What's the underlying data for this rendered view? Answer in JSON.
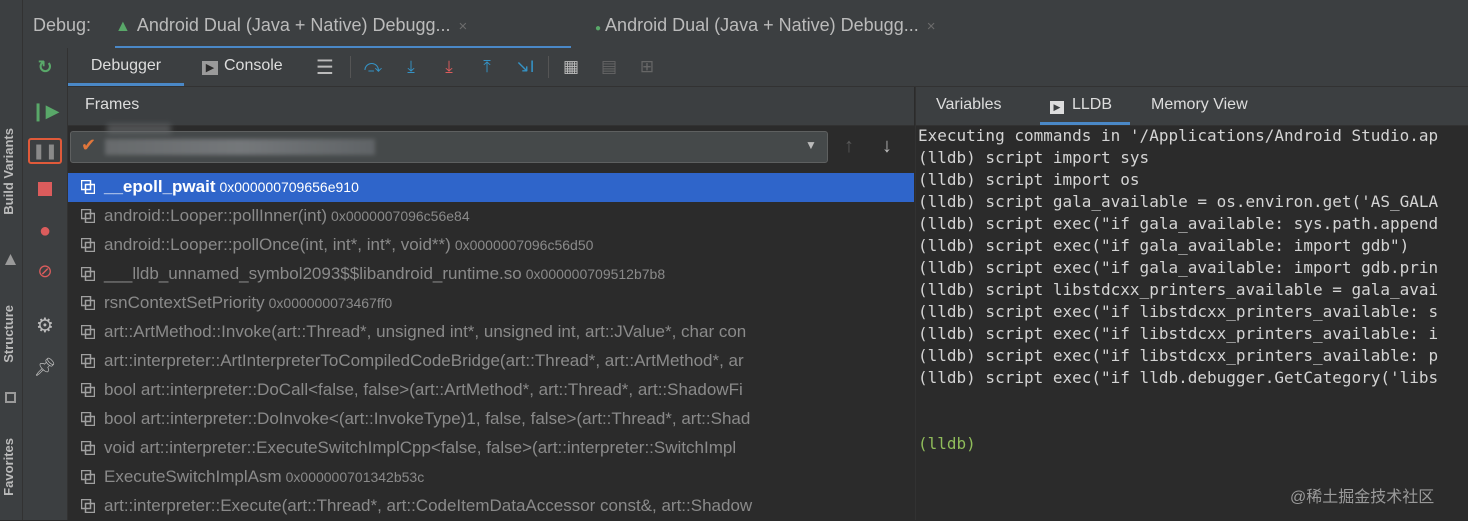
{
  "left_strip": {
    "labels": [
      "Build Variants",
      "Structure",
      "Favorites"
    ]
  },
  "header": {
    "debug_label": "Debug:",
    "sessions": [
      {
        "label": "Android Dual (Java + Native) Debugg...",
        "close": "×"
      },
      {
        "label": "Android Dual (Java + Native) Debugg...",
        "close": "×"
      }
    ]
  },
  "toolbar": {
    "tabs": [
      {
        "label": "Debugger"
      },
      {
        "label": "Console"
      }
    ],
    "icons": [
      "menu-icon",
      "step-over-icon",
      "step-into-icon",
      "force-step-into-icon",
      "step-out-icon",
      "run-to-cursor-icon",
      "evaluate-icon",
      "grid-icon",
      "grid2-icon"
    ]
  },
  "frames": {
    "title": "Frames",
    "items": [
      {
        "name": "__epoll_pwait",
        "addr": "0x000000709656e910",
        "selected": true
      },
      {
        "name": "android::Looper::pollInner(int)",
        "addr": "0x0000007096c56e84"
      },
      {
        "name": "android::Looper::pollOnce(int, int*, int*, void**)",
        "addr": "0x0000007096c56d50"
      },
      {
        "name": "___lldb_unnamed_symbol2093$$libandroid_runtime.so",
        "addr": "0x000000709512b7b8"
      },
      {
        "name": "rsnContextSetPriority",
        "addr": "0x000000073467ff0"
      },
      {
        "name": "art::ArtMethod::Invoke(art::Thread*, unsigned int*, unsigned int, art::JValue*, char con",
        "addr": ""
      },
      {
        "name": "art::interpreter::ArtInterpreterToCompiledCodeBridge(art::Thread*, art::ArtMethod*, ar",
        "addr": ""
      },
      {
        "name": "bool art::interpreter::DoCall<false, false>(art::ArtMethod*, art::Thread*, art::ShadowFi",
        "addr": ""
      },
      {
        "name": "bool art::interpreter::DoInvoke<(art::InvokeType)1, false, false>(art::Thread*, art::Shad",
        "addr": ""
      },
      {
        "name": "void art::interpreter::ExecuteSwitchImplCpp<false, false>(art::interpreter::SwitchImpl",
        "addr": ""
      },
      {
        "name": "ExecuteSwitchImplAsm",
        "addr": "0x000000701342b53c"
      },
      {
        "name": "art::interpreter::Execute(art::Thread*, art::CodeItemDataAccessor const&, art::Shadow",
        "addr": ""
      }
    ]
  },
  "right": {
    "tabs": [
      {
        "label": "Variables"
      },
      {
        "label": "LLDB"
      },
      {
        "label": "Memory View"
      }
    ],
    "lldb_lines": [
      "Executing commands in '/Applications/Android Studio.ap",
      "(lldb) script import sys",
      "(lldb) script import os",
      "(lldb) script gala_available = os.environ.get('AS_GALA",
      "(lldb) script exec(\"if gala_available: sys.path.append",
      "(lldb) script exec(\"if gala_available: import gdb\")",
      "(lldb) script exec(\"if gala_available: import gdb.prin",
      "(lldb) script libstdcxx_printers_available = gala_avai",
      "(lldb) script exec(\"if libstdcxx_printers_available: s",
      "(lldb) script exec(\"if libstdcxx_printers_available: i",
      "(lldb) script exec(\"if libstdcxx_printers_available: p",
      "(lldb) script exec(\"if lldb.debugger.GetCategory('libs"
    ],
    "prompt": "(lldb)",
    "watermark": "@稀土掘金技术社区"
  },
  "colors": {
    "accent": "#4a88c7",
    "selection": "#2f65ca",
    "green": "#59a869",
    "red": "#db5c5c",
    "blue_icon": "#3592c4"
  }
}
